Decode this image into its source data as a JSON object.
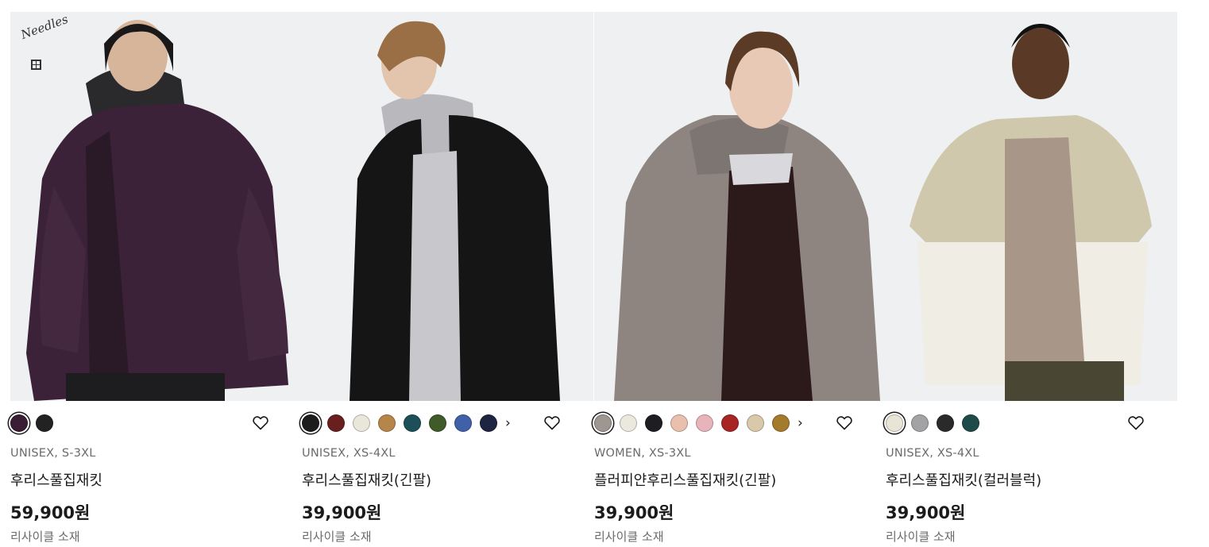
{
  "products": [
    {
      "badge_brand": "Needles",
      "swatches": [
        {
          "color": "#3a1e36",
          "selected": true
        },
        {
          "color": "#222222",
          "selected": false
        }
      ],
      "has_more": false,
      "more_icon": "›",
      "favorite_icon": "heart-outline",
      "meta": "UNISEX, S-3XL",
      "name": "후리스풀집재킷",
      "price": "59,900원",
      "note": "리사이클 소재"
    },
    {
      "swatches": [
        {
          "color": "#1c1c1c",
          "selected": true
        },
        {
          "color": "#6a1f1f",
          "selected": false
        },
        {
          "color": "#e9e6da",
          "selected": false
        },
        {
          "color": "#b5854a",
          "selected": false
        },
        {
          "color": "#1d4f59",
          "selected": false
        },
        {
          "color": "#3f5b2a",
          "selected": false
        },
        {
          "color": "#4060a8",
          "selected": false
        },
        {
          "color": "#1e2540",
          "selected": false
        }
      ],
      "has_more": true,
      "more_icon": "›",
      "favorite_icon": "heart-outline",
      "meta": "UNISEX, XS-4XL",
      "name": "후리스풀집재킷(긴팔)",
      "price": "39,900원",
      "note": "리사이클 소재"
    },
    {
      "swatches": [
        {
          "color": "#9e9690",
          "selected": true
        },
        {
          "color": "#ebe8de",
          "selected": false
        },
        {
          "color": "#1e1e22",
          "selected": false
        },
        {
          "color": "#e9bfae",
          "selected": false
        },
        {
          "color": "#e8b4bc",
          "selected": false
        },
        {
          "color": "#a82524",
          "selected": false
        },
        {
          "color": "#d9c9aa",
          "selected": false
        },
        {
          "color": "#a47a2c",
          "selected": false
        }
      ],
      "has_more": true,
      "more_icon": "›",
      "favorite_icon": "heart-outline",
      "meta": "WOMEN, XS-3XL",
      "name": "플러피얀후리스풀집재킷(긴팔)",
      "price": "39,900원",
      "note": "리사이클 소재"
    },
    {
      "swatches": [
        {
          "color": "#e9e5d6",
          "selected": true
        },
        {
          "color": "#a3a3a6",
          "selected": false
        },
        {
          "color": "#2a2a2a",
          "selected": false
        },
        {
          "color": "#1f4a4a",
          "selected": false
        }
      ],
      "has_more": false,
      "more_icon": "›",
      "favorite_icon": "heart-outline",
      "meta": "UNISEX, XS-4XL",
      "name": "후리스풀집재킷(컬러블럭)",
      "price": "39,900원",
      "note": "리사이클 소재"
    }
  ]
}
